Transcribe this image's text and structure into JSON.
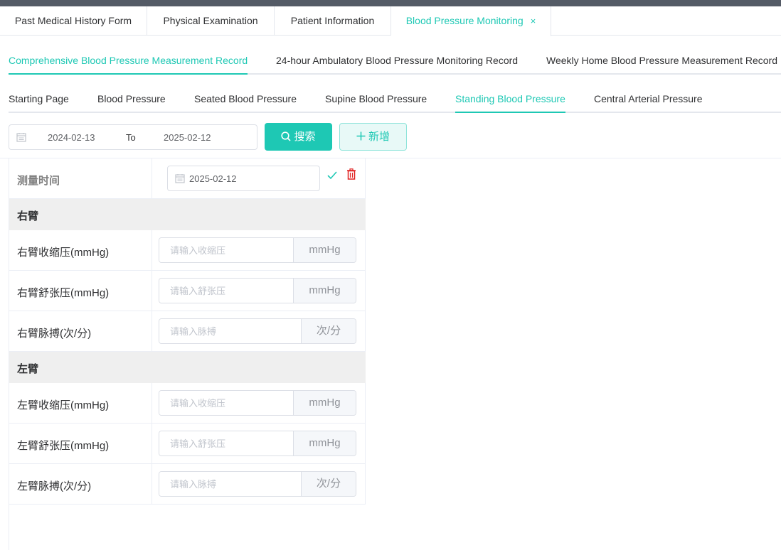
{
  "tabs": [
    {
      "label": "Past Medical History Form"
    },
    {
      "label": "Physical Examination"
    },
    {
      "label": "Patient Information"
    },
    {
      "label": "Blood Pressure Monitoring",
      "close": "×"
    }
  ],
  "subtabs": [
    {
      "label": "Comprehensive Blood Pressure Measurement Record"
    },
    {
      "label": "24-hour Ambulatory Blood Pressure Monitoring Record"
    },
    {
      "label": "Weekly Home Blood Pressure Measurement Record"
    }
  ],
  "thirdtabs": [
    {
      "label": "Starting Page"
    },
    {
      "label": "Blood Pressure"
    },
    {
      "label": "Seated Blood Pressure"
    },
    {
      "label": "Supine Blood Pressure"
    },
    {
      "label": "Standing Blood Pressure"
    },
    {
      "label": "Central Arterial Pressure"
    }
  ],
  "filter": {
    "start_date": "2024-02-13",
    "to_label": "To",
    "end_date": "2025-02-12",
    "search_label": "搜索",
    "add_label": "新增"
  },
  "form": {
    "time_label": "测量时间",
    "time_value": "2025-02-12",
    "right_section": "右臂",
    "left_section": "左臂",
    "right_fields": [
      {
        "label": "右臂收缩压(mmHg)",
        "placeholder": "请输入收缩压",
        "unit": "mmHg"
      },
      {
        "label": "右臂舒张压(mmHg)",
        "placeholder": "请输入舒张压",
        "unit": "mmHg"
      },
      {
        "label": "右臂脉搏(次/分)",
        "placeholder": "请输入脉搏",
        "unit": "次/分"
      }
    ],
    "left_fields": [
      {
        "label": "左臂收缩压(mmHg)",
        "placeholder": "请输入收缩压",
        "unit": "mmHg"
      },
      {
        "label": "左臂舒张压(mmHg)",
        "placeholder": "请输入舒张压",
        "unit": "mmHg"
      },
      {
        "label": "左臂脉搏(次/分)",
        "placeholder": "请输入脉搏",
        "unit": "次/分"
      }
    ]
  },
  "colors": {
    "accent": "#1ec8b4",
    "danger": "#e02020",
    "topbar": "#545b66",
    "section_bg": "#efefef"
  },
  "icons": [
    "calendar-icon",
    "search-icon",
    "plus-icon",
    "check-icon",
    "trash-icon",
    "close-icon"
  ]
}
